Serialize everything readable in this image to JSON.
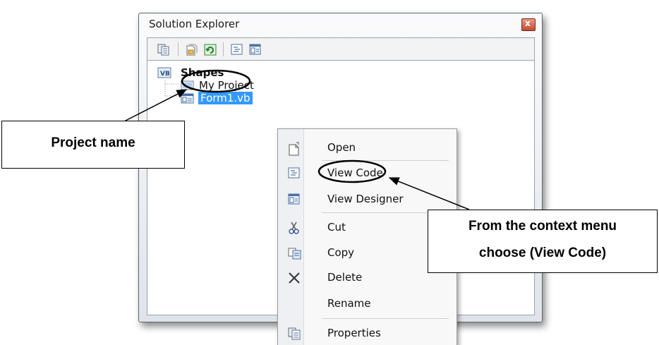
{
  "window": {
    "title": "Solution Explorer",
    "close_glyph": "x"
  },
  "toolbar": {
    "icons": [
      "properties-icon",
      "show-all-files-icon",
      "refresh-icon",
      "view-code-icon",
      "view-designer-icon"
    ]
  },
  "tree": {
    "project": "Shapes",
    "children": [
      "My Project",
      "Form1.vb"
    ],
    "selected": "Form1.vb"
  },
  "context_menu": {
    "items": [
      {
        "label": "Open",
        "icon": "open-icon"
      },
      {
        "label": "View Code",
        "icon": "view-code-icon"
      },
      {
        "label": "View Designer",
        "icon": "view-designer-icon"
      },
      {
        "label": "Cut",
        "icon": "scissors-icon"
      },
      {
        "label": "Copy",
        "icon": "copy-icon"
      },
      {
        "label": "Delete",
        "icon": "delete-x-icon"
      },
      {
        "label": "Rename",
        "icon": ""
      },
      {
        "label": "Properties",
        "icon": "properties-icon"
      }
    ]
  },
  "annotations": {
    "project_name": "Project name",
    "context_line1": "From the context menu",
    "context_line2": "choose (View Code)"
  },
  "colors": {
    "selection": "#3399ff",
    "window_border": "#5d6673",
    "close_button": "#c24a2f"
  }
}
